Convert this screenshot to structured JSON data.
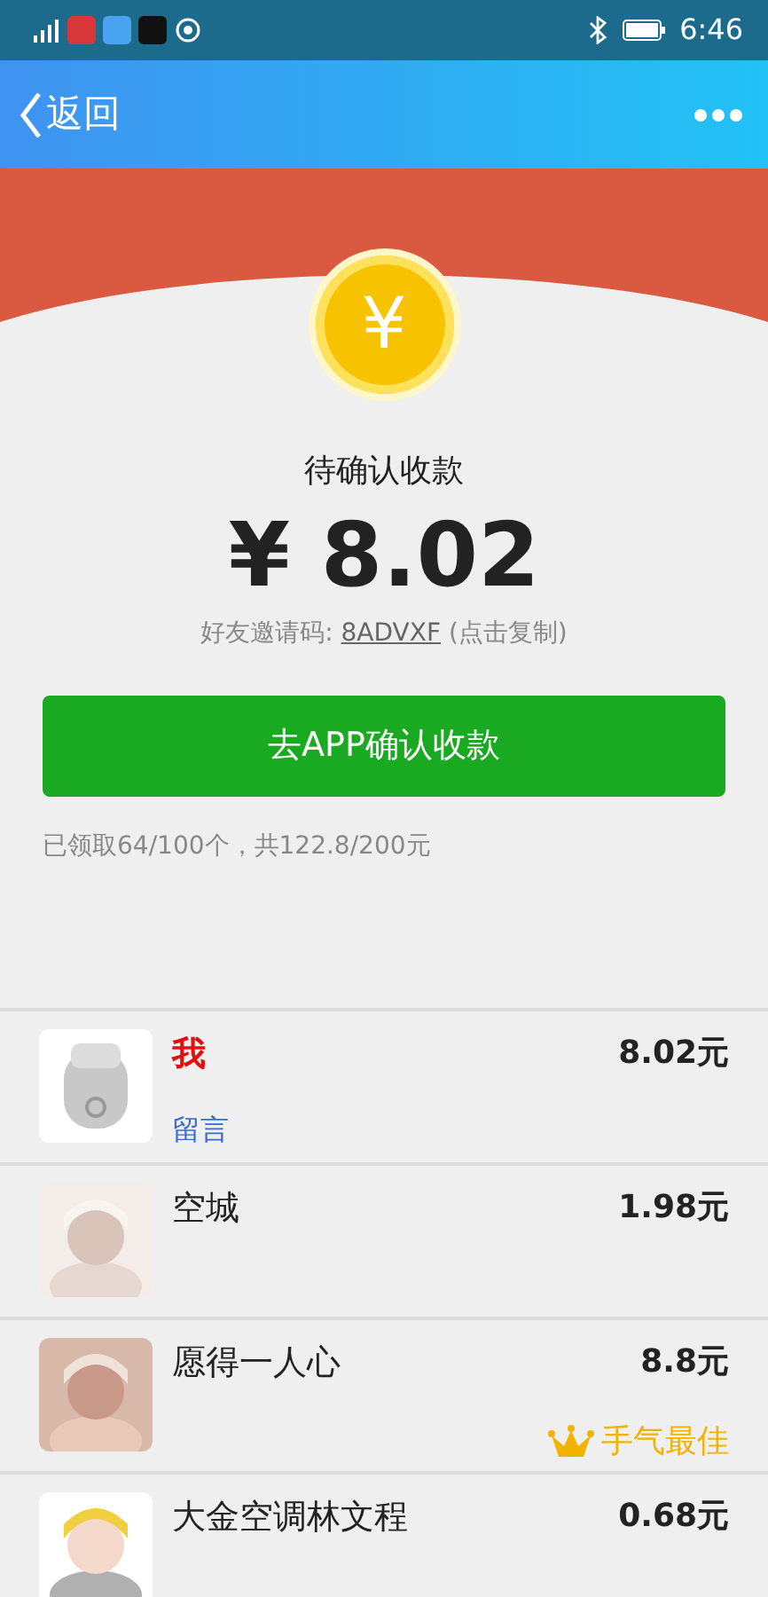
{
  "status_bar": {
    "time": "6:46"
  },
  "header": {
    "back_label": "返回"
  },
  "coin": {
    "symbol": "¥"
  },
  "status_label": "待确认收款",
  "amount": "¥ 8.02",
  "invite": {
    "label": "好友邀请码:",
    "code": "8ADVXF",
    "hint": "(点击复制)"
  },
  "confirm_button": "去APP确认收款",
  "summary": "已领取64/100个，共122.8/200元",
  "recipients": [
    {
      "name": "我",
      "is_self": true,
      "amount": "8.02元",
      "avatar": {
        "kind": "default"
      },
      "note": "留言"
    },
    {
      "name": "空城",
      "is_self": false,
      "amount": "1.98元"
    },
    {
      "name": "愿得一人心",
      "is_self": false,
      "amount": "8.8元",
      "best": "手气最佳"
    },
    {
      "name": "大金空调林文程",
      "is_self": false,
      "amount": "0.68元"
    }
  ]
}
